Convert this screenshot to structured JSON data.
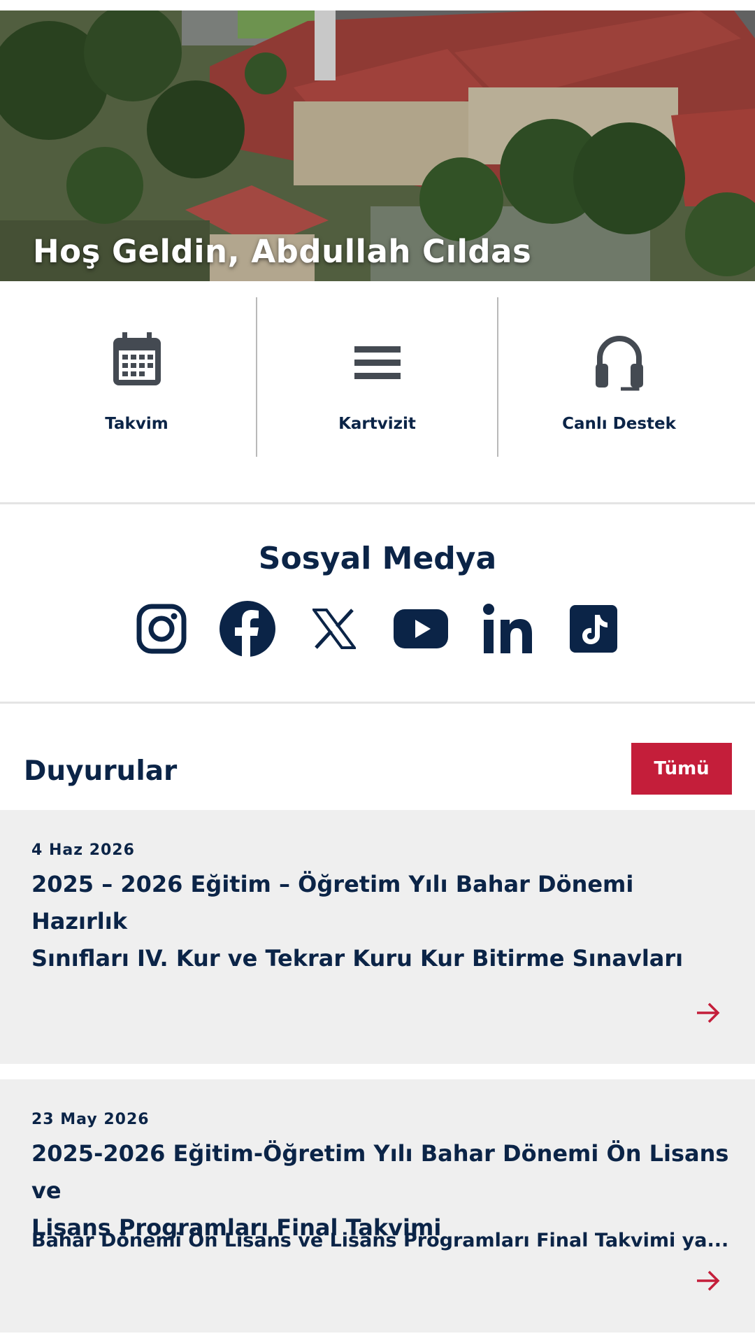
{
  "hero": {
    "welcome_text": "Hoş Geldin, Abdullah Cıldas"
  },
  "quick_actions": [
    {
      "label": "Takvim",
      "icon": "calendar-icon"
    },
    {
      "label": "Kartvizit",
      "icon": "card-lines-icon"
    },
    {
      "label": "Canlı Destek",
      "icon": "headset-icon"
    }
  ],
  "social": {
    "title": "Sosyal Medya",
    "icons": [
      "instagram-icon",
      "facebook-icon",
      "x-icon",
      "youtube-icon",
      "linkedin-icon",
      "tiktok-icon"
    ]
  },
  "announcements": {
    "title": "Duyurular",
    "all_label": "Tümü",
    "items": [
      {
        "date": "4 Haz 2026",
        "title_line1": "2025 – 2026 Eğitim – Öğretim Yılı Bahar Dönemi Hazırlık",
        "title_line2": "Sınıfları IV. Kur ve Tekrar Kuru Kur Bitirme Sınavları",
        "description": ""
      },
      {
        "date": "23 May 2026",
        "title_line1": "2025-2026 Eğitim-Öğretim Yılı Bahar Dönemi Ön Lisans ve",
        "title_line2": "Lisans Programları Final Takvimi",
        "description": "Bahar Dönemi Ön Lisans ve Lisans Programları Final Takvimi ya..."
      }
    ]
  },
  "colors": {
    "navy": "#0b2447",
    "accent_red": "#c41e3a",
    "card_bg": "#efefef"
  }
}
